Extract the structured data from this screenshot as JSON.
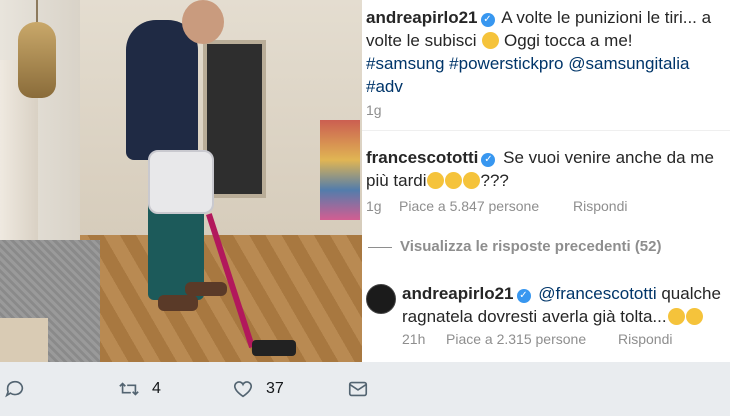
{
  "post": {
    "caption": {
      "username": "andreapirlo21",
      "text": "A volte le punizioni le tiri... a volte le subisci",
      "text2": " Oggi tocca a me!",
      "hashtags": [
        "#samsung",
        "#powerstickpro",
        "@samsungitalia",
        "#adv"
      ],
      "time": "1g"
    },
    "comments": [
      {
        "username": "francescototti",
        "text": "Se vuoi venire anche da me più tardi",
        "text_suffix": "???",
        "time": "1g",
        "likes": "Piace a 5.847 persone",
        "reply": "Rispondi"
      }
    ],
    "view_replies": "Visualizza le risposte precedenti (52)",
    "reply": {
      "username": "andreapirlo21",
      "mention": "@francescototti",
      "text": "qualche ragnatela dovresti averla già tolta...",
      "time": "21h",
      "likes": "Piace a 2.315 persone",
      "reply": "Rispondi"
    }
  },
  "tweet_actions": {
    "reply_icon": "comment-icon",
    "retweet_icon": "retweet-icon",
    "retweet_count": "4",
    "like_icon": "heart-icon",
    "like_count": "37",
    "share_icon": "mail-icon"
  },
  "colors": {
    "verified": "#3897f0",
    "link": "#003569",
    "muted": "#8e8e8e"
  }
}
